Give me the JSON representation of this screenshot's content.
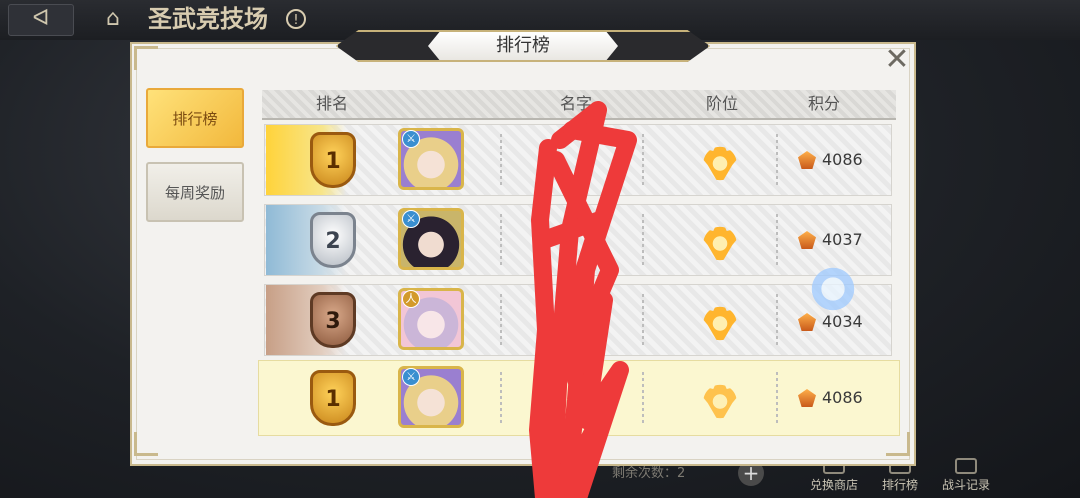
{
  "topbar": {
    "back_icon": "back-arrow-icon",
    "home_icon": "home-icon",
    "title": "圣武竞技场"
  },
  "panel": {
    "title": "排行榜"
  },
  "tabs": [
    {
      "label": "排行榜"
    },
    {
      "label": "每周奖励"
    }
  ],
  "header": {
    "rank": "排名",
    "name": "名字",
    "tier": "阶位",
    "score": "积分"
  },
  "rows": [
    {
      "rank": "1",
      "avatar": "blonde-girl-avatar",
      "class_icon": "blue-class-icon",
      "name": "",
      "tier_icon": "gold-wing-tier-icon",
      "score": "4086"
    },
    {
      "rank": "2",
      "avatar": "dark-hair-girl-avatar",
      "class_icon": "blue-class-icon",
      "name": "",
      "tier_icon": "gold-wing-tier-icon",
      "score": "4037"
    },
    {
      "rank": "3",
      "avatar": "lilac-hair-girl-avatar",
      "class_icon": "gold-class-icon",
      "name": "",
      "tier_icon": "gold-wing-tier-icon",
      "score": "4034"
    }
  ],
  "self_row": {
    "rank": "1",
    "avatar": "blonde-girl-avatar",
    "class_icon": "blue-class-icon",
    "name": "",
    "tier_icon": "gold-wing-tier-icon",
    "score": "4086"
  },
  "bottom": {
    "remaining": "剩余次数：2",
    "shop": "兑换商店",
    "ranking": "排行榜",
    "battle_log": "战斗记录"
  },
  "colors": {
    "panel_bg": "#f3f2ef",
    "gold_accent": "#c9b98d",
    "self_row_bg": "#fbf7d0",
    "scribble": "#ee3a3a"
  }
}
